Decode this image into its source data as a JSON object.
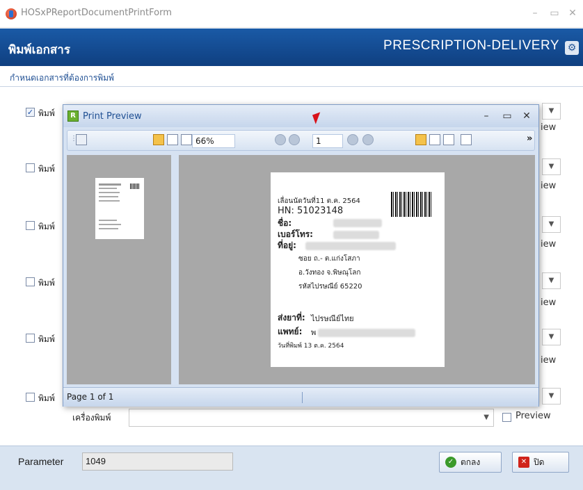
{
  "window": {
    "title": "HOSxPReportDocumentPrintForm",
    "min": "–",
    "max": "▭",
    "close": "✕"
  },
  "header": {
    "title": "พิมพ์เอกสาร",
    "report_name": "PRESCRIPTION-DELIVERY"
  },
  "subheader": {
    "label": "กำหนดเอกสารที่ต้องการพิมพ์"
  },
  "rows": [
    {
      "label": "พิมพ์",
      "checked": true
    },
    {
      "label": "พิมพ์",
      "checked": false
    },
    {
      "label": "พิมพ์",
      "checked": false
    },
    {
      "label": "พิมพ์",
      "checked": false
    },
    {
      "label": "พิมพ์",
      "checked": false
    },
    {
      "label": "พิมพ์",
      "checked": false
    }
  ],
  "preview_stub": "iew",
  "printer": {
    "label": "เครื่องพิมพ์",
    "value": "",
    "preview_label": "Preview"
  },
  "footer": {
    "param_label": "Parameter",
    "param_value": "1049",
    "ok_label": "ตกลง",
    "close_label": "ปิด"
  },
  "print_preview": {
    "title": "Print Preview",
    "zoom": "66%",
    "page_number": "1",
    "status": "Page 1 of 1",
    "more": "»",
    "document": {
      "appt_line": "เลื่อนนัดวันที่11 ต.ค. 2564",
      "hn": "HN:  51023148",
      "name_label": "ชื่อ:",
      "phone_label": "เบอร์โทร:",
      "address_label": "ที่อยู่:",
      "addr1": "ซอย  ถ.- ต.แก่งโสภา",
      "addr2": "อ.วังทอง จ.พิษณุโลก",
      "addr3": "รหัสไปรษณีย์ 65220",
      "ship_label": "ส่งยาที่:",
      "ship_value": "ไปรษณีย์ไทย",
      "doctor_label": "แพทย์:",
      "doctor_value": "พ",
      "print_date": "วันที่พิมพ์ 13 ต.ค. 2564"
    }
  },
  "colors": {
    "header_bg": "#1a5aa6",
    "footer_bg": "#d9e4f1",
    "accent": "#1f4f93"
  }
}
